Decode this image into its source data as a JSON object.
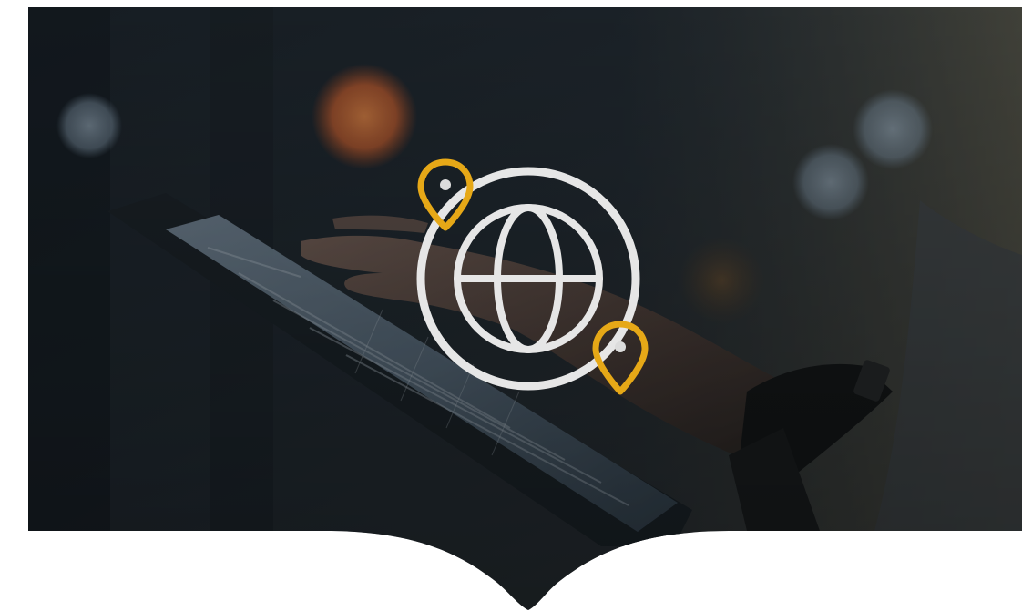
{
  "hero": {
    "icons": {
      "center": "globe-icon",
      "pins": [
        "location-pin-icon",
        "location-pin-icon"
      ],
      "bottom": "chevron-down-icon"
    },
    "colors": {
      "background": "#ffffff",
      "photo_dark": "#14191f",
      "photo_mid": "#2a3138",
      "warm_glow": "#e0783c",
      "cool_glow": "#9fb4c7",
      "globe_stroke": "#e6e6e6",
      "pin_gold": "#e6a817",
      "pin_dot": "#dcdcdc"
    }
  }
}
